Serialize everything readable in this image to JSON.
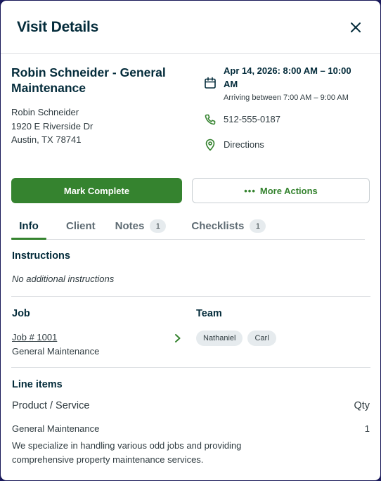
{
  "modal": {
    "title": "Visit Details",
    "close_icon": "close-icon"
  },
  "visit": {
    "title": "Robin Schneider - General Maintenance",
    "address_lines": [
      "Robin Schneider",
      "1920 E Riverside Dr",
      "Austin, TX 78741"
    ],
    "date": "Apr 14, 2026: 8:00 AM – 10:00 AM",
    "arrival": "Arriving between 7:00 AM – 9:00 AM",
    "phone": "512-555-0187",
    "directions": "Directions"
  },
  "actions": {
    "primary": "Mark Complete",
    "secondary": "More Actions"
  },
  "tabs": [
    {
      "label": "Info",
      "active": true
    },
    {
      "label": "Client"
    },
    {
      "label": "Notes",
      "badge": "1"
    },
    {
      "label": "Checklists",
      "badge": "1"
    }
  ],
  "instructions": {
    "title": "Instructions",
    "text": "No additional instructions"
  },
  "job": {
    "title": "Job",
    "link": "Job # 1001",
    "description": "General Maintenance"
  },
  "team": {
    "title": "Team",
    "members": [
      "Nathaniel",
      "Carl"
    ]
  },
  "line_items": {
    "title": "Line items",
    "col_product": "Product / Service",
    "col_qty": "Qty",
    "rows": [
      {
        "name": "General Maintenance",
        "qty": "1",
        "description": "We specialize in handling various odd jobs and providing comprehensive property maintenance services."
      }
    ]
  },
  "colors": {
    "accent": "#35832f",
    "heading": "#032b3a",
    "text": "#2f3b40"
  }
}
